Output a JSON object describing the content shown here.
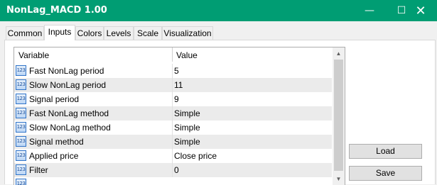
{
  "window": {
    "title": "NonLag_MACD 1.00",
    "minimize_glyph": "—",
    "maximize_glyph": "☐",
    "close_glyph": "✕"
  },
  "tabs": [
    {
      "label": "Common",
      "active": false
    },
    {
      "label": "Inputs",
      "active": true
    },
    {
      "label": "Colors",
      "active": false
    },
    {
      "label": "Levels",
      "active": false
    },
    {
      "label": "Scale",
      "active": false
    },
    {
      "label": "Visualization",
      "active": false
    }
  ],
  "table": {
    "headers": {
      "variable": "Variable",
      "value": "Value"
    },
    "type_icon": "123",
    "rows": [
      {
        "name": "Fast NonLag period",
        "value": "5"
      },
      {
        "name": "Slow NonLag period",
        "value": "11"
      },
      {
        "name": "Signal period",
        "value": "9"
      },
      {
        "name": "Fast NonLag method",
        "value": "Simple"
      },
      {
        "name": "Slow NonLag method",
        "value": "Simple"
      },
      {
        "name": "Signal method",
        "value": "Simple"
      },
      {
        "name": "Applied price",
        "value": "Close price"
      },
      {
        "name": "Filter",
        "value": "0"
      }
    ]
  },
  "scrollbar": {
    "up": "▲",
    "down": "▼"
  },
  "buttons": {
    "load": "Load",
    "save": "Save"
  },
  "colors": {
    "titlebar": "#009d73"
  }
}
